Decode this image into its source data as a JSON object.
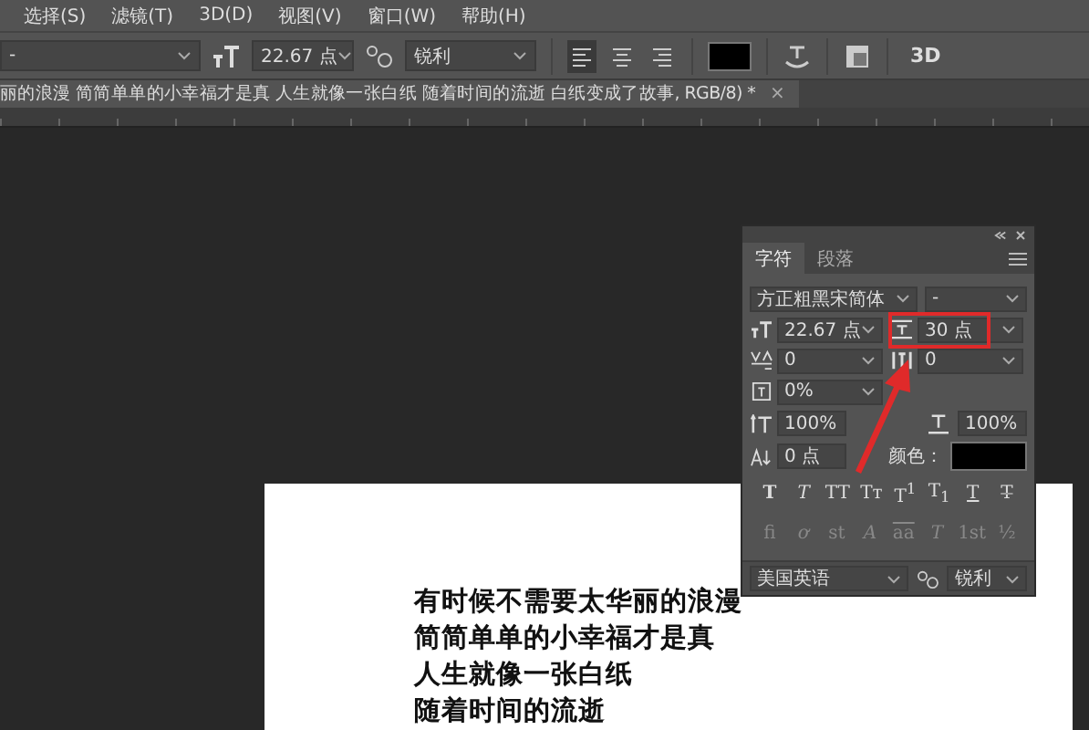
{
  "menu": [
    "选择(S)",
    "滤镜(T)",
    "3D(D)",
    "视图(V)",
    "窗口(W)",
    "帮助(H)"
  ],
  "options_bar": {
    "font_style": "-",
    "font_size": "22.67 点",
    "antialias": "锐利",
    "align": [
      {
        "kind": "left",
        "selected": true
      },
      {
        "kind": "center",
        "selected": false
      },
      {
        "kind": "right",
        "selected": false
      }
    ],
    "three_d": "3D"
  },
  "document_tab": {
    "title": "丽的浪漫 简简单单的小幸福才是真 人生就像一张白纸 随着时间的流逝 白纸变成了故事, RGB/8) *",
    "close": "×"
  },
  "canvas_text": [
    "有时候不需要太华丽的浪漫",
    "简简单单的小幸福才是真",
    "人生就像一张白纸",
    "随着时间的流逝"
  ],
  "character_panel": {
    "tabs": [
      {
        "label": "字符",
        "selected": true
      },
      {
        "label": "段落",
        "selected": false
      }
    ],
    "font_family": "方正粗黑宋简体",
    "font_style": "-",
    "fields": [
      {
        "kind": "size",
        "value": "22.67 点"
      },
      {
        "kind": "leading",
        "value": "30 点"
      },
      {
        "kind": "kerning",
        "value": "0"
      },
      {
        "kind": "tracking",
        "value": "0"
      },
      {
        "kind": "tsume",
        "value": "0%"
      },
      {
        "kind": "vscale",
        "value": "100%"
      },
      {
        "kind": "hscale",
        "value": "100%"
      },
      {
        "kind": "baseline",
        "value": "0 点"
      }
    ],
    "color_label": "颜色：",
    "type_buttons": [
      {
        "label": "T",
        "kind": "bold",
        "disabled": false
      },
      {
        "label": "T",
        "kind": "italic",
        "disabled": false
      },
      {
        "label": "TT",
        "kind": "plain",
        "disabled": false
      },
      {
        "label": "Tт",
        "kind": "plain",
        "disabled": false
      },
      {
        "label": "T$^{1}$",
        "kind": "plain",
        "disabled": false
      },
      {
        "label": "T$_{1}$",
        "kind": "plain",
        "disabled": false
      },
      {
        "label": "T",
        "kind": "underline",
        "disabled": false
      },
      {
        "label": "T",
        "kind": "strike",
        "disabled": false
      }
    ],
    "opentype_buttons": [
      {
        "label": "fi",
        "kind": "plain",
        "disabled": true
      },
      {
        "label": "ơ",
        "kind": "italic",
        "disabled": true
      },
      {
        "label": "st",
        "kind": "plain",
        "disabled": true
      },
      {
        "label": "A",
        "kind": "italic",
        "disabled": true
      },
      {
        "label": "aa",
        "kind": "overline",
        "disabled": true
      },
      {
        "label": "T",
        "kind": "italic",
        "disabled": true
      },
      {
        "label": "1st",
        "kind": "plain",
        "disabled": true
      },
      {
        "label": "½",
        "kind": "plain",
        "disabled": true
      }
    ],
    "language": "美国英语",
    "antialias": "锐利"
  }
}
